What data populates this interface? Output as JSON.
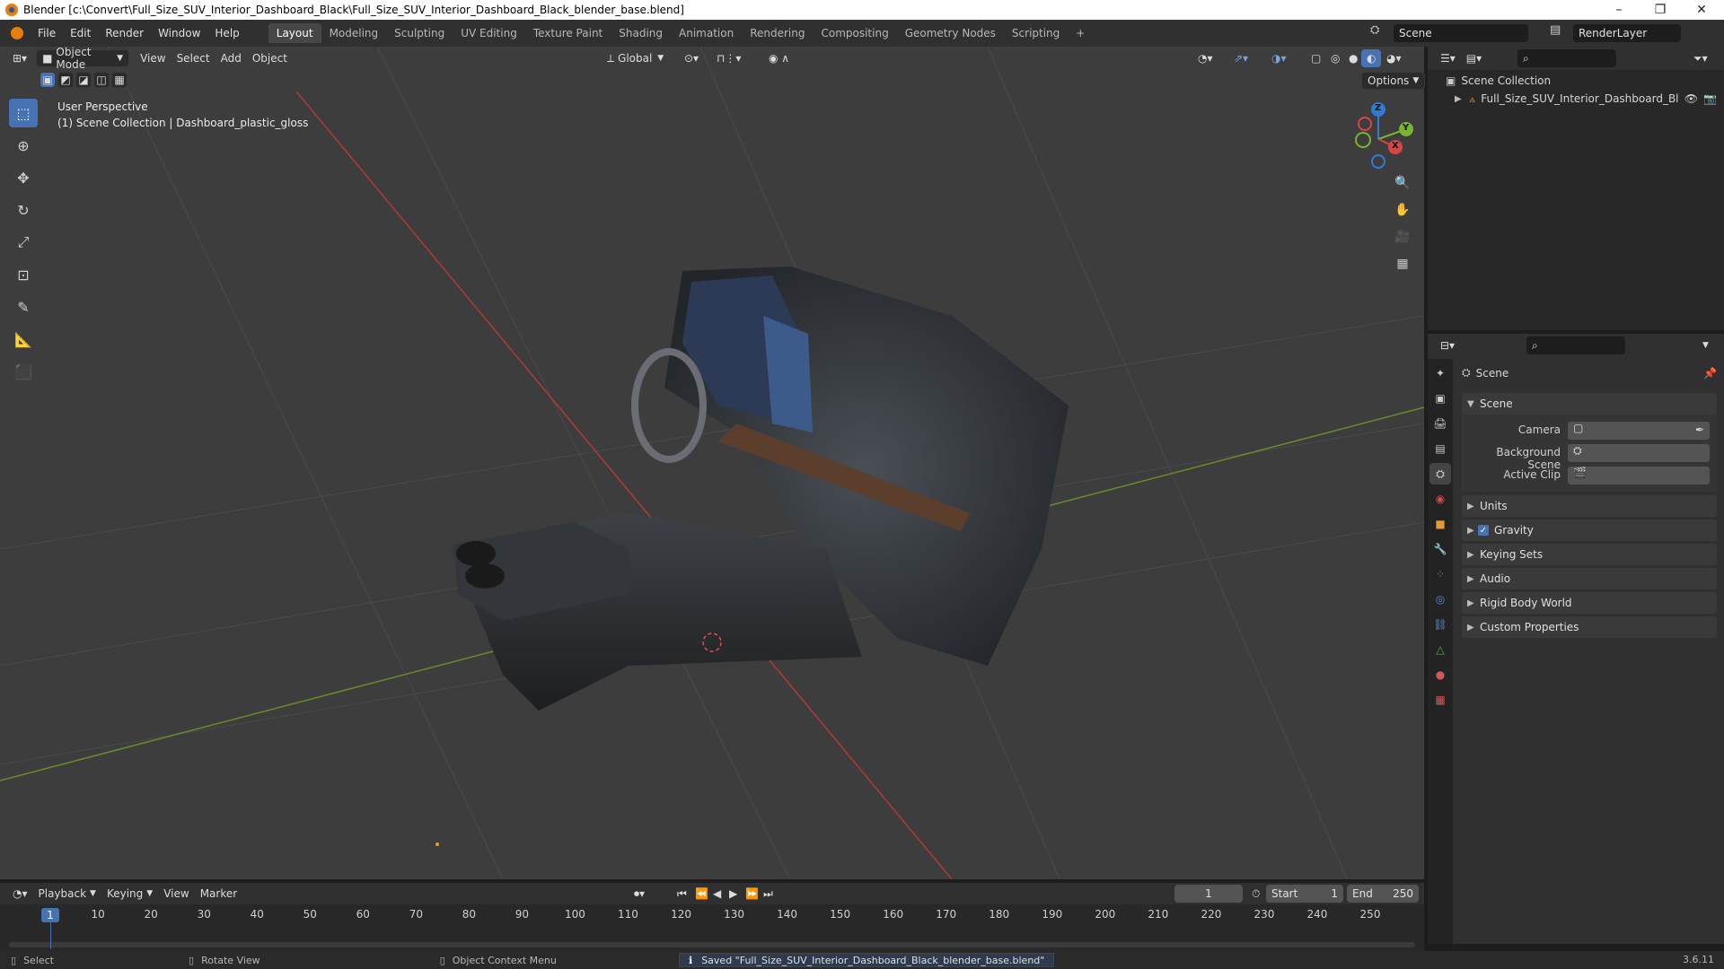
{
  "window": {
    "title": "Blender [c:\\Convert\\Full_Size_SUV_Interior_Dashboard_Black\\Full_Size_SUV_Interior_Dashboard_Black_blender_base.blend]",
    "minimize": "–",
    "maximize": "❐",
    "close": "✕"
  },
  "menu": [
    "File",
    "Edit",
    "Render",
    "Window",
    "Help"
  ],
  "workspaces": [
    "Layout",
    "Modeling",
    "Sculpting",
    "UV Editing",
    "Texture Paint",
    "Shading",
    "Animation",
    "Rendering",
    "Compositing",
    "Geometry Nodes",
    "Scripting"
  ],
  "workspace_add": "+",
  "scene_selector": "Scene",
  "view_layer": "RenderLayer",
  "viewport": {
    "mode": "Object Mode",
    "menus": [
      "View",
      "Select",
      "Add",
      "Object"
    ],
    "orientation": "Global",
    "options": "Options",
    "perspective": "User Perspective",
    "context": "(1) Scene Collection | Dashboard_plastic_gloss",
    "gizmo": {
      "x": "X",
      "y": "Y",
      "z": "Z"
    }
  },
  "tools": [
    "select-box-icon",
    "cursor-icon",
    "move-icon",
    "rotate-icon",
    "scale-icon",
    "transform-icon",
    "annotate-icon",
    "measure-icon",
    "add-cube-icon"
  ],
  "outliner": {
    "root": "Scene Collection",
    "items": [
      {
        "name": "Full_Size_SUV_Interior_Dashboard_Blacl"
      }
    ]
  },
  "properties": {
    "breadcrumb": "Scene",
    "panel_title": "Scene",
    "fields": [
      {
        "label": "Camera",
        "value": ""
      },
      {
        "label": "Background Scene",
        "value": ""
      },
      {
        "label": "Active Clip",
        "value": ""
      }
    ],
    "sections": [
      {
        "label": "Units",
        "checkbox": false
      },
      {
        "label": "Gravity",
        "checkbox": true
      },
      {
        "label": "Keying Sets",
        "checkbox": false
      },
      {
        "label": "Audio",
        "checkbox": false
      },
      {
        "label": "Rigid Body World",
        "checkbox": false
      },
      {
        "label": "Custom Properties",
        "checkbox": false
      }
    ]
  },
  "timeline": {
    "menus": [
      "Playback",
      "Keying",
      "View",
      "Marker"
    ],
    "current_frame": "1",
    "start_label": "Start",
    "start": "1",
    "end_label": "End",
    "end": "250",
    "ticks": [
      "1",
      "10",
      "20",
      "30",
      "40",
      "50",
      "60",
      "70",
      "80",
      "90",
      "100",
      "110",
      "120",
      "130",
      "140",
      "150",
      "160",
      "170",
      "180",
      "190",
      "200",
      "210",
      "220",
      "230",
      "240",
      "250"
    ]
  },
  "status": {
    "select": "Select",
    "rotate": "Rotate View",
    "context_menu": "Object Context Menu",
    "message": "Saved \"Full_Size_SUV_Interior_Dashboard_Black_blender_base.blend\"",
    "version": "3.6.11"
  }
}
